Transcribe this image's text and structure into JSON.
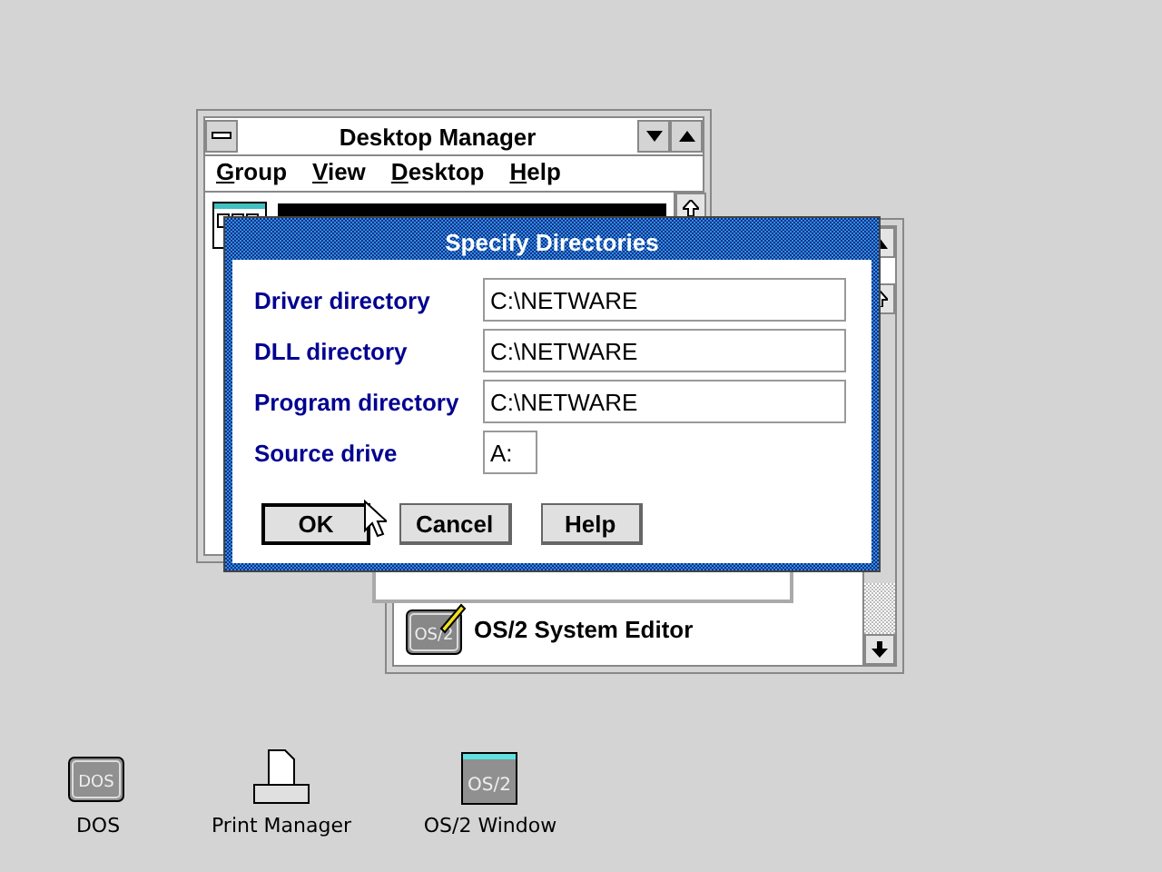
{
  "desktop_manager": {
    "title": "Desktop Manager",
    "menu": [
      "Group",
      "View",
      "Desktop",
      "Help"
    ],
    "groups": [
      {
        "selected": true
      }
    ]
  },
  "group_window": {
    "items": [
      {
        "label": "OS/2 System Editor",
        "icon_text": "OS/2"
      }
    ]
  },
  "dialog": {
    "title": "Specify Directories",
    "fields": [
      {
        "label": "Driver directory",
        "value": "C:\\NETWARE",
        "kind": "long"
      },
      {
        "label": "DLL directory",
        "value": "C:\\NETWARE",
        "kind": "long"
      },
      {
        "label": "Program directory",
        "value": "C:\\NETWARE",
        "kind": "long"
      },
      {
        "label": "Source drive",
        "value": "A:",
        "kind": "short"
      }
    ],
    "buttons": [
      {
        "label": "OK",
        "default": true
      },
      {
        "label": "Cancel",
        "default": false
      },
      {
        "label": "Help",
        "default": false
      }
    ]
  },
  "desktop_icons": [
    {
      "kind": "dos",
      "label": "DOS",
      "icon_text": "DOS"
    },
    {
      "kind": "printer",
      "label": "Print Manager"
    },
    {
      "kind": "window",
      "label": "OS/2 Window",
      "icon_text": "OS/2"
    }
  ]
}
